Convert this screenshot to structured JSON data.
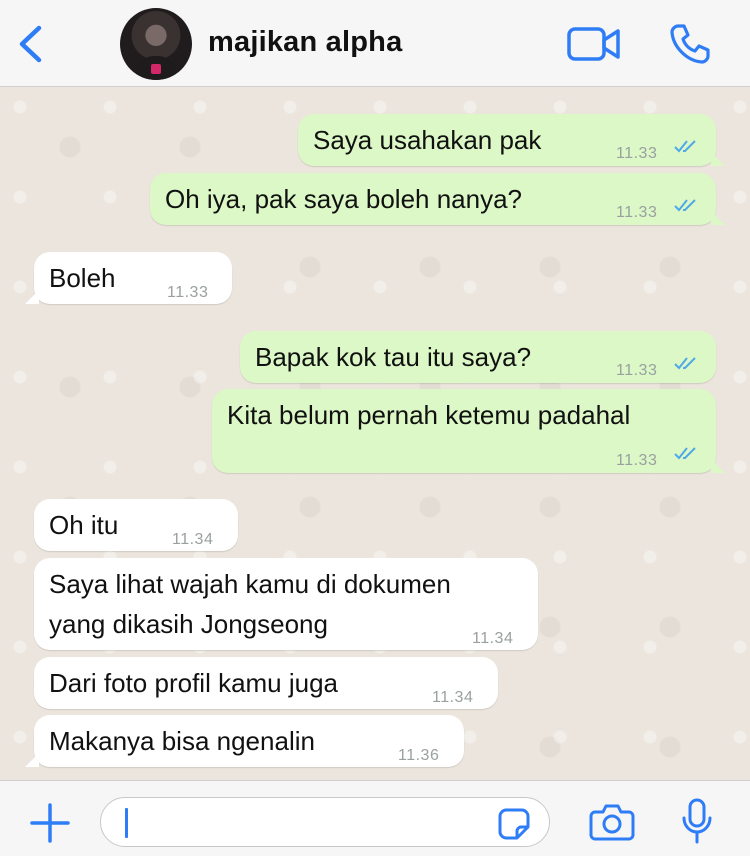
{
  "header": {
    "contact_name": "majikan alpha",
    "icons": [
      "back-chevron-icon",
      "avatar",
      "video-call-icon",
      "phone-call-icon"
    ]
  },
  "messages": [
    {
      "dir": "out",
      "text": "Saya usahakan pak",
      "time": "11.33",
      "status": "read"
    },
    {
      "dir": "out",
      "text": "Oh iya, pak saya boleh nanya?",
      "time": "11.33",
      "status": "read"
    },
    {
      "dir": "in",
      "text": "Boleh",
      "time": "11.33"
    },
    {
      "dir": "out",
      "text": "Bapak kok tau itu saya?",
      "time": "11.33",
      "status": "read"
    },
    {
      "dir": "out",
      "text": "Kita belum pernah ketemu padahal",
      "time": "11.33",
      "status": "read"
    },
    {
      "dir": "in",
      "text": "Oh itu",
      "time": "11.34"
    },
    {
      "dir": "in",
      "text_line1": "Saya lihat wajah kamu di dokumen",
      "text_line2": "yang dikasih Jongseong",
      "time": "11.34"
    },
    {
      "dir": "in",
      "text": "Dari foto profil kamu juga",
      "time": "11.34"
    },
    {
      "dir": "in",
      "text": "Makanya bisa ngenalin",
      "time": "11.36"
    }
  ],
  "composer": {
    "value": "",
    "icons": [
      "plus-icon",
      "sticker-icon",
      "camera-icon",
      "microphone-icon"
    ]
  },
  "colors": {
    "accent": "#2f7df6",
    "outgoing_bubble": "#dcf8c6",
    "incoming_bubble": "#ffffff",
    "read_tick": "#4fa8e8",
    "chat_background": "#ebe5dd"
  }
}
